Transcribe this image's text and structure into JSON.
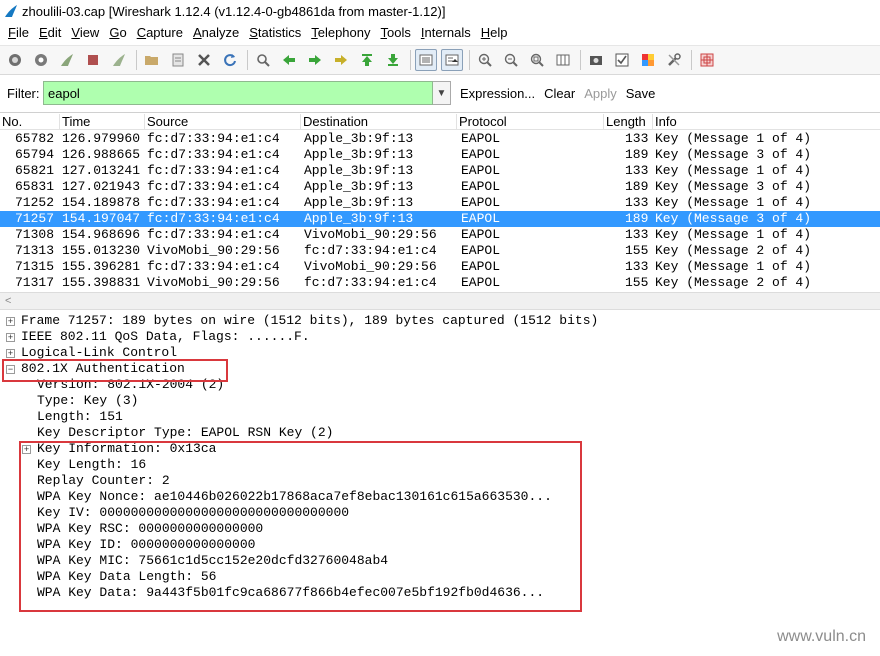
{
  "window": {
    "title": "zhoulili-03.cap   [Wireshark 1.12.4  (v1.12.4-0-gb4861da from master-1.12)]"
  },
  "menu": [
    "File",
    "Edit",
    "View",
    "Go",
    "Capture",
    "Analyze",
    "Statistics",
    "Telephony",
    "Tools",
    "Internals",
    "Help"
  ],
  "filter": {
    "label": "Filter:",
    "value": "eapol",
    "expression": "Expression...",
    "clear": "Clear",
    "apply": "Apply",
    "save": "Save",
    "colors": {
      "background": "#afffaf"
    }
  },
  "columns": [
    "No.",
    "Time",
    "Source",
    "Destination",
    "Protocol",
    "Length",
    "Info"
  ],
  "packets": [
    {
      "no": "65782",
      "time": "126.979960",
      "source": "fc:d7:33:94:e1:c4",
      "destination": "Apple_3b:9f:13",
      "protocol": "EAPOL",
      "length": "133",
      "info": "Key (Message 1 of 4)"
    },
    {
      "no": "65794",
      "time": "126.988665",
      "source": "fc:d7:33:94:e1:c4",
      "destination": "Apple_3b:9f:13",
      "protocol": "EAPOL",
      "length": "189",
      "info": "Key (Message 3 of 4)"
    },
    {
      "no": "65821",
      "time": "127.013241",
      "source": "fc:d7:33:94:e1:c4",
      "destination": "Apple_3b:9f:13",
      "protocol": "EAPOL",
      "length": "133",
      "info": "Key (Message 1 of 4)"
    },
    {
      "no": "65831",
      "time": "127.021943",
      "source": "fc:d7:33:94:e1:c4",
      "destination": "Apple_3b:9f:13",
      "protocol": "EAPOL",
      "length": "189",
      "info": "Key (Message 3 of 4)"
    },
    {
      "no": "71252",
      "time": "154.189878",
      "source": "fc:d7:33:94:e1:c4",
      "destination": "Apple_3b:9f:13",
      "protocol": "EAPOL",
      "length": "133",
      "info": "Key (Message 1 of 4)"
    },
    {
      "no": "71257",
      "time": "154.197047",
      "source": "fc:d7:33:94:e1:c4",
      "destination": "Apple_3b:9f:13",
      "protocol": "EAPOL",
      "length": "189",
      "info": "Key (Message 3 of 4)"
    },
    {
      "no": "71308",
      "time": "154.968696",
      "source": "fc:d7:33:94:e1:c4",
      "destination": "VivoMobi_90:29:56",
      "protocol": "EAPOL",
      "length": "133",
      "info": "Key (Message 1 of 4)"
    },
    {
      "no": "71313",
      "time": "155.013230",
      "source": "VivoMobi_90:29:56",
      "destination": "fc:d7:33:94:e1:c4",
      "protocol": "EAPOL",
      "length": "155",
      "info": "Key (Message 2 of 4)"
    },
    {
      "no": "71315",
      "time": "155.396281",
      "source": "fc:d7:33:94:e1:c4",
      "destination": "VivoMobi_90:29:56",
      "protocol": "EAPOL",
      "length": "133",
      "info": "Key (Message 1 of 4)"
    },
    {
      "no": "71317",
      "time": "155.398831",
      "source": "VivoMobi_90:29:56",
      "destination": "fc:d7:33:94:e1:c4",
      "protocol": "EAPOL",
      "length": "155",
      "info": "Key (Message 2 of 4)"
    }
  ],
  "selected_packet": "71257",
  "selection_color": "#3399ff",
  "details": {
    "frame": "Frame 71257: 189 bytes on wire (1512 bits), 189 bytes captured (1512 bits)",
    "ieee": "IEEE 802.11 QoS Data, Flags: ......F.",
    "llc": "Logical-Link Control",
    "auth": "802.1X Authentication",
    "version": "Version: 802.1X-2004 (2)",
    "type": "Type: Key (3)",
    "length": "Length: 151",
    "key_descriptor": "Key Descriptor Type: EAPOL RSN Key (2)",
    "key_info": "Key Information: 0x13ca",
    "key_length": "Key Length: 16",
    "replay": "Replay Counter: 2",
    "nonce": "WPA Key Nonce: ae10446b026022b17868aca7ef8ebac130161c615a663530...",
    "iv": "Key IV: 00000000000000000000000000000000",
    "rsc": "WPA Key RSC: 0000000000000000",
    "id": "WPA Key ID: 0000000000000000",
    "mic": "WPA Key MIC: 75661c1d5cc152e20dcfd32760048ab4",
    "data_length": "WPA Key Data Length: 56",
    "data": "WPA Key Data: 9a443f5b01fc9ca68677f866b4efec007e5bf192fb0d4636..."
  },
  "annotation_color": "#d9383d",
  "watermark": "www.vuln.cn"
}
